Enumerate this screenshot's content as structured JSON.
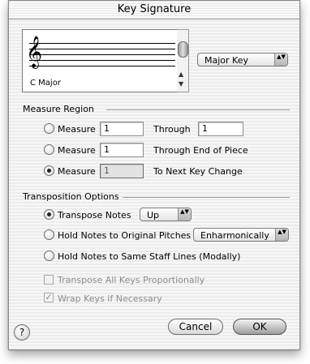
{
  "window": {
    "title": "Key Signature"
  },
  "preview": {
    "key_name": "C Major",
    "clef": "𝄞"
  },
  "mode_popup": {
    "value": "Major Key",
    "caret": "▲▼"
  },
  "measure_region": {
    "label": "Measure Region",
    "rows": [
      {
        "radio_label": "Measure",
        "from": "1",
        "through_label": "Through",
        "to": "1",
        "selected": false
      },
      {
        "radio_label": "Measure",
        "from": "1",
        "through_label": "Through End of Piece",
        "selected": false
      },
      {
        "radio_label": "Measure",
        "from": "1",
        "through_label": "To Next Key Change",
        "selected": true
      }
    ]
  },
  "transposition": {
    "label": "Transposition Options",
    "transpose_notes": {
      "label": "Transpose Notes",
      "direction": "Up",
      "selected": true
    },
    "hold_original": {
      "label": "Hold Notes to Original Pitches",
      "mode": "Enharmonically",
      "selected": false
    },
    "hold_staff": {
      "label": "Hold Notes to Same Staff Lines (Modally)",
      "selected": false
    },
    "transpose_all": {
      "label": "Transpose All Keys Proportionally",
      "checked": false,
      "enabled": false
    },
    "wrap_keys": {
      "label": "Wrap Keys if Necessary",
      "checked": true,
      "enabled": false,
      "mark": "✓"
    }
  },
  "buttons": {
    "help": "?",
    "cancel": "Cancel",
    "ok": "OK"
  },
  "scroll": {
    "up": "▲",
    "down": "▼"
  }
}
